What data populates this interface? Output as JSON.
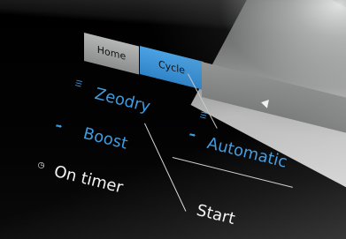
{
  "tabs": {
    "home": "Home",
    "cycle": "Cycle"
  },
  "left_menu": {
    "items": [
      {
        "label": "Zeodry",
        "icon": "list-icon"
      },
      {
        "label": "Boost",
        "icon": "boost-arrow-icon"
      },
      {
        "label": "On timer",
        "icon": "clock-icon"
      }
    ]
  },
  "right_panel": {
    "header_arrow": "back-arrow-icon",
    "program_label": "Automatic",
    "start_label": "Start"
  },
  "colors": {
    "accent_blue": "#3f9be0",
    "tab_active": "#2f84c8",
    "tab_inactive": "#9a9b9b"
  }
}
